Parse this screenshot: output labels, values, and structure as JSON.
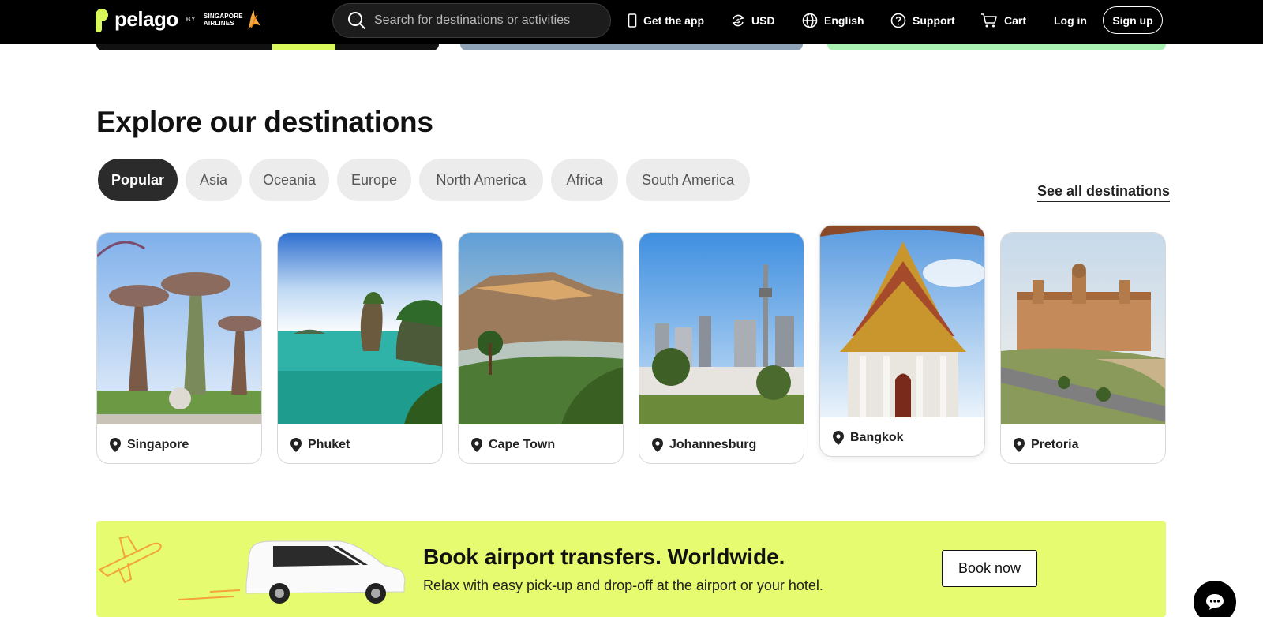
{
  "header": {
    "brand": "pelago",
    "by": "BY",
    "partner_line1": "SINGAPORE",
    "partner_line2": "AIRLINES",
    "search_placeholder": "Search for destinations or activities",
    "get_app": "Get the app",
    "currency": "USD",
    "language": "English",
    "support": "Support",
    "cart": "Cart",
    "login": "Log in",
    "signup": "Sign up"
  },
  "destinations": {
    "title": "Explore our destinations",
    "see_all": "See all destinations",
    "regions": [
      {
        "label": "Popular",
        "active": true
      },
      {
        "label": "Asia",
        "active": false
      },
      {
        "label": "Oceania",
        "active": false
      },
      {
        "label": "Europe",
        "active": false
      },
      {
        "label": "North America",
        "active": false
      },
      {
        "label": "Africa",
        "active": false
      },
      {
        "label": "South America",
        "active": false
      }
    ],
    "cards": [
      {
        "name": "Singapore"
      },
      {
        "name": "Phuket"
      },
      {
        "name": "Cape Town"
      },
      {
        "name": "Johannesburg"
      },
      {
        "name": "Bangkok"
      },
      {
        "name": "Pretoria"
      }
    ]
  },
  "promo": {
    "title": "Book airport transfers. Worldwide.",
    "subtitle": "Relax with easy pick-up and drop-off at the airport or your hotel.",
    "cta": "Book now"
  },
  "colors": {
    "accent": "#e6fb6f",
    "topbar": "#000000",
    "chip_active": "#2b2b2b",
    "chip": "#ececec"
  }
}
